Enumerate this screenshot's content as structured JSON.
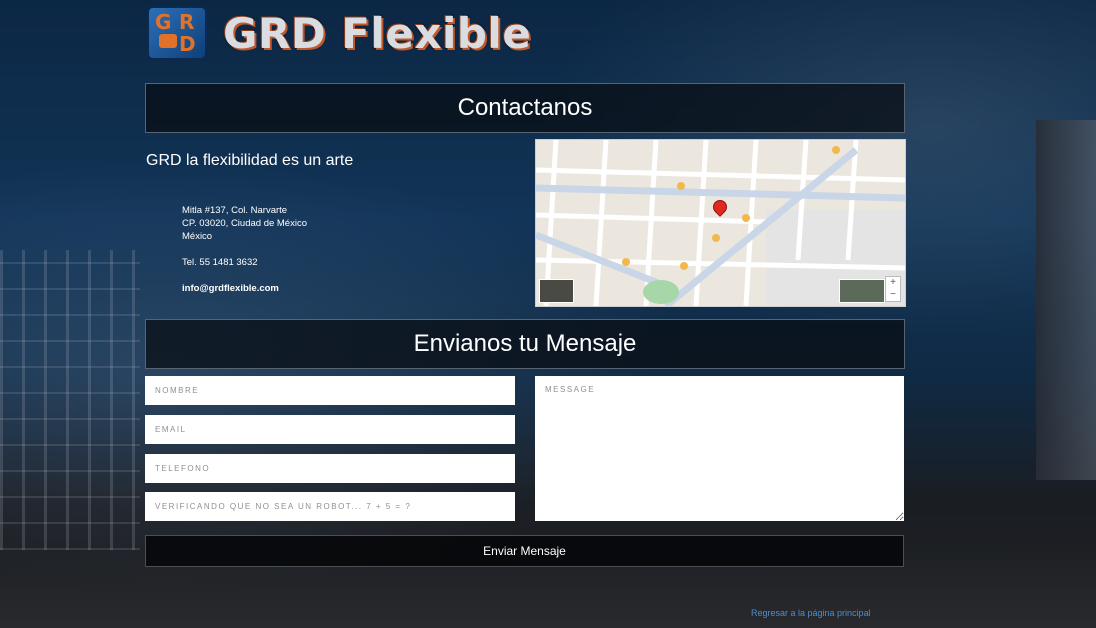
{
  "brand": {
    "logo_letters": [
      "G",
      "R",
      "D"
    ],
    "name": "GRD Flexible"
  },
  "contact": {
    "title": "Contactanos",
    "tagline": "GRD la flexibilidad es un arte",
    "address_lines": [
      "Mitla #137, Col. Narvarte",
      "CP. 03020, Ciudad de México",
      "México"
    ],
    "phone": "Tel. 55 1481 3632",
    "email": "info@grdflexible.com"
  },
  "map": {
    "zoom_in": "+",
    "zoom_out": "−"
  },
  "form": {
    "title": "Envianos tu Mensaje",
    "nombre_placeholder": "NOMBRE",
    "email_placeholder": "EMAIL",
    "telefono_placeholder": "TELEFONO",
    "robot_placeholder": "VERIFICANDO QUE NO SEA UN ROBOT... 7 + 5 = ?",
    "message_placeholder": "MESSAGE",
    "submit_label": "Enviar Mensaje"
  },
  "footer": {
    "back_link": "Regresar a la página principal"
  },
  "colors": {
    "accent_orange": "#e0722a",
    "link_blue": "#4a8fd0",
    "header_bg": "#080c12"
  }
}
